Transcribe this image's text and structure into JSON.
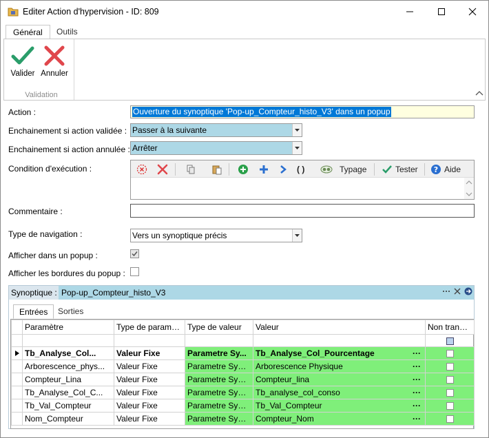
{
  "window": {
    "title": "Editer Action d'hypervision - ID: 809",
    "icon": "folder-icon"
  },
  "ribbon": {
    "tabs": [
      {
        "label": "Général",
        "active": true
      },
      {
        "label": "Outils",
        "active": false
      }
    ],
    "buttons": {
      "validate": "Valider",
      "cancel": "Annuler"
    },
    "group_label": "Validation"
  },
  "form": {
    "action_label": "Action :",
    "action_value": "Ouverture du synoptique 'Pop-up_Compteur_histo_V3' dans un popup",
    "on_valid_label": "Enchainement si action validée :",
    "on_valid_value": "Passer à la suivante",
    "on_cancel_label": "Enchainement si action annulée :",
    "on_cancel_value": "Arrêter",
    "condition_label": "Condition d'exécution :",
    "condition_toolbar": {
      "parens": "( )",
      "typage": "Typage",
      "tester": "Tester",
      "aide": "Aide"
    },
    "comment_label": "Commentaire :",
    "comment_value": "",
    "nav_type_label": "Type de navigation :",
    "nav_type_value": "Vers un synoptique précis",
    "popup_label": "Afficher dans un popup :",
    "popup_checked": true,
    "borders_label": "Afficher les bordures du popup :",
    "borders_checked": false
  },
  "synoptique": {
    "label": "Synoptique :",
    "value": "Pop-up_Compteur_histo_V3",
    "tabs": [
      {
        "label": "Entrées",
        "active": true
      },
      {
        "label": "Sorties",
        "active": false
      }
    ],
    "columns": [
      "Paramètre",
      "Type de paramètre",
      "Type de valeur",
      "Valeur",
      "Non transmis"
    ],
    "rows": [
      {
        "param": "Tb_Analyse_Col...",
        "ptype": "Valeur Fixe",
        "vtype": "Parametre Sy...",
        "value": "Tb_Analyse_Col_Pourcentage",
        "dots": "···",
        "selected": true
      },
      {
        "param": "Arborescence_phys...",
        "ptype": "Valeur Fixe",
        "vtype": "Parametre Syno...",
        "value": "Arborescence Physique",
        "dots": "···",
        "selected": false
      },
      {
        "param": "Compteur_Lina",
        "ptype": "Valeur Fixe",
        "vtype": "Parametre Syno...",
        "value": "Compteur_lina",
        "dots": "···",
        "selected": false
      },
      {
        "param": "Tb_Analyse_Col_C...",
        "ptype": "Valeur Fixe",
        "vtype": "Parametre Syno...",
        "value": "Tb_analyse_col_conso",
        "dots": "···",
        "selected": false
      },
      {
        "param": "Tb_Val_Compteur",
        "ptype": "Valeur Fixe",
        "vtype": "Parametre Syno...",
        "value": "Tb_Val_Compteur",
        "dots": "···",
        "selected": false
      },
      {
        "param": "Nom_Compteur",
        "ptype": "Valeur Fixe",
        "vtype": "Parametre Syno...",
        "value": "Compteur_Nom",
        "dots": "···",
        "selected": false
      }
    ]
  },
  "colors": {
    "accent_blue": "#add8e6",
    "green_cell": "#7fef7a",
    "selection": "#0078d7",
    "action_bg": "#ffffe0"
  }
}
